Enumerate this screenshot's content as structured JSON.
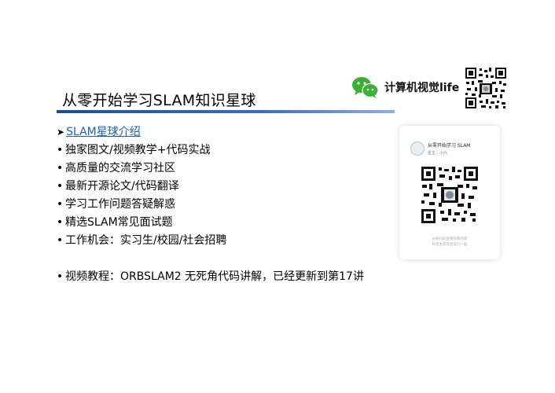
{
  "title": "从零开始学习SLAM知识星球",
  "brand": {
    "name": "计算机视觉life",
    "logo_icon": "wechat-logo-icon",
    "accent": "#3cb034"
  },
  "colors": {
    "title_line": "#1f4e9b",
    "link": "#1d5fb7"
  },
  "list": {
    "intro_arrow": "➤",
    "intro_link": "SLAM星球介绍",
    "bullet": "•",
    "items": [
      "独家图文/视频教学+代码实战",
      "高质量的交流学习社区",
      "最新开源论文/代码翻译",
      "学习工作问题答疑解惑",
      "精选SLAM常见面试题",
      "工作机会：实习生/校园/社会招聘"
    ],
    "video": "视频教程：ORBSLAM2 无死角代码讲解，已经更新到第17讲"
  },
  "card": {
    "title": "从零开始学习 SLAM",
    "owner": "星主：小六",
    "footer_line1": "长按扫码查看社群内容",
    "footer_line2": "和星主及其星友们一起"
  }
}
